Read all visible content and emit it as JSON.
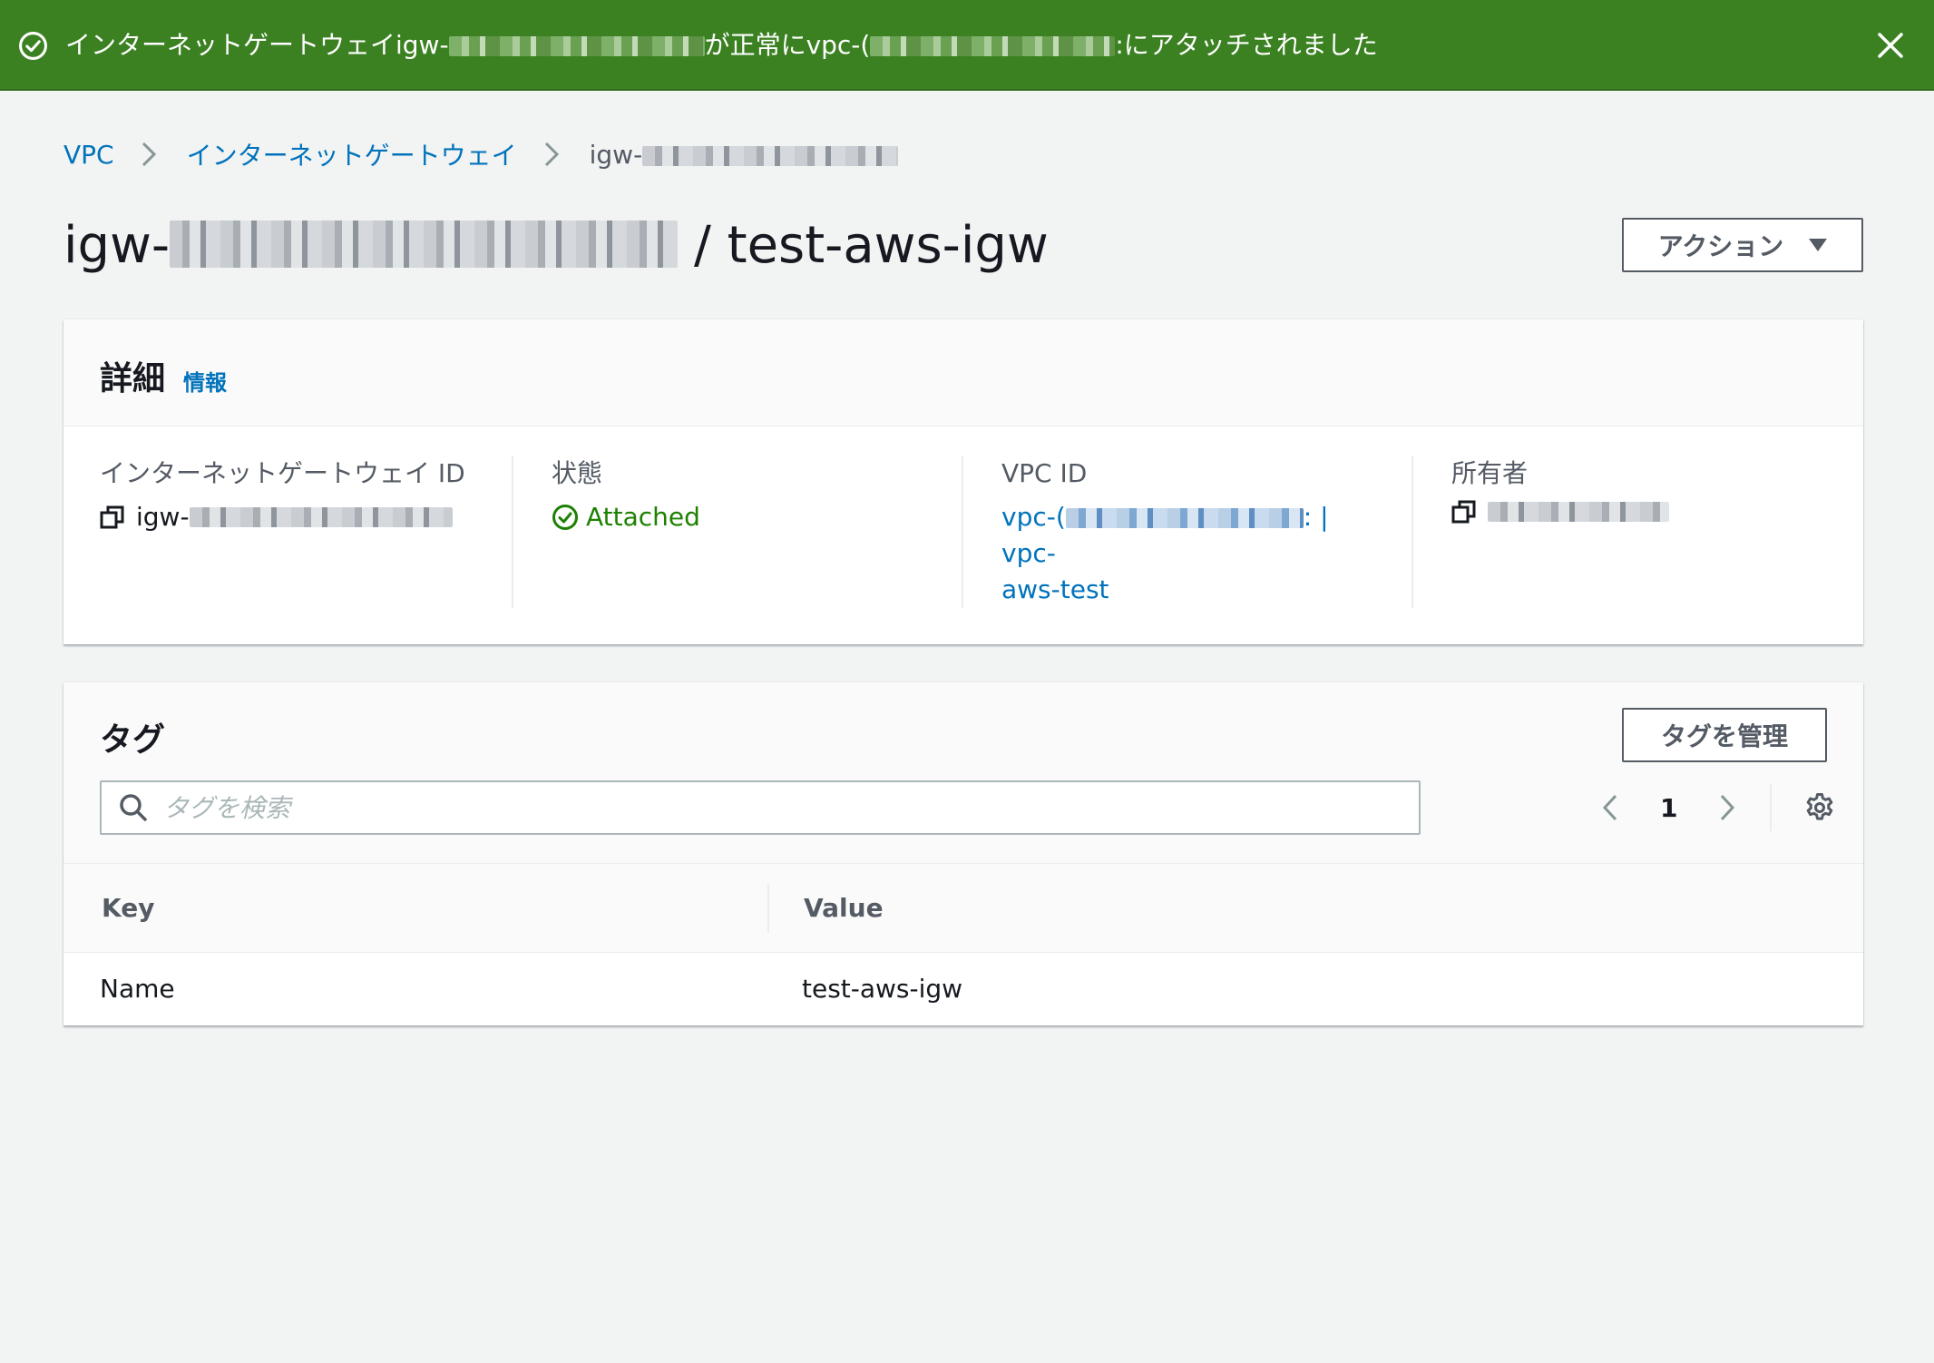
{
  "flash": {
    "message_prefix": "インターネットゲートウェイigw-",
    "message_middle": "が正常にvpc-(",
    "message_suffix": ":にアタッチされました"
  },
  "breadcrumb": {
    "items": [
      "VPC",
      "インターネットゲートウェイ"
    ],
    "current": "igw-"
  },
  "page": {
    "title_prefix": "igw-",
    "title_suffix": "/ test-aws-igw",
    "actions_label": "アクション"
  },
  "details": {
    "heading": "詳細",
    "info_link": "情報",
    "fields": {
      "igw_id_label": "インターネットゲートウェイ ID",
      "igw_id_value": "igw-",
      "state_label": "状態",
      "state_value": "Attached",
      "vpc_id_label": "VPC ID",
      "vpc_id_value_line1_prefix": "vpc-(",
      "vpc_id_value_line1_suffix": ": | vpc-",
      "vpc_id_value_line2": "aws-test",
      "owner_label": "所有者"
    }
  },
  "tags": {
    "heading": "タグ",
    "manage_label": "タグを管理",
    "search_placeholder": "タグを検索",
    "page": "1",
    "columns": [
      "Key",
      "Value"
    ],
    "rows": [
      {
        "key": "Name",
        "value": "test-aws-igw"
      }
    ]
  },
  "colors": {
    "flash_success": "#3b8121",
    "link": "#0073bb",
    "status_ok": "#1d8102"
  }
}
